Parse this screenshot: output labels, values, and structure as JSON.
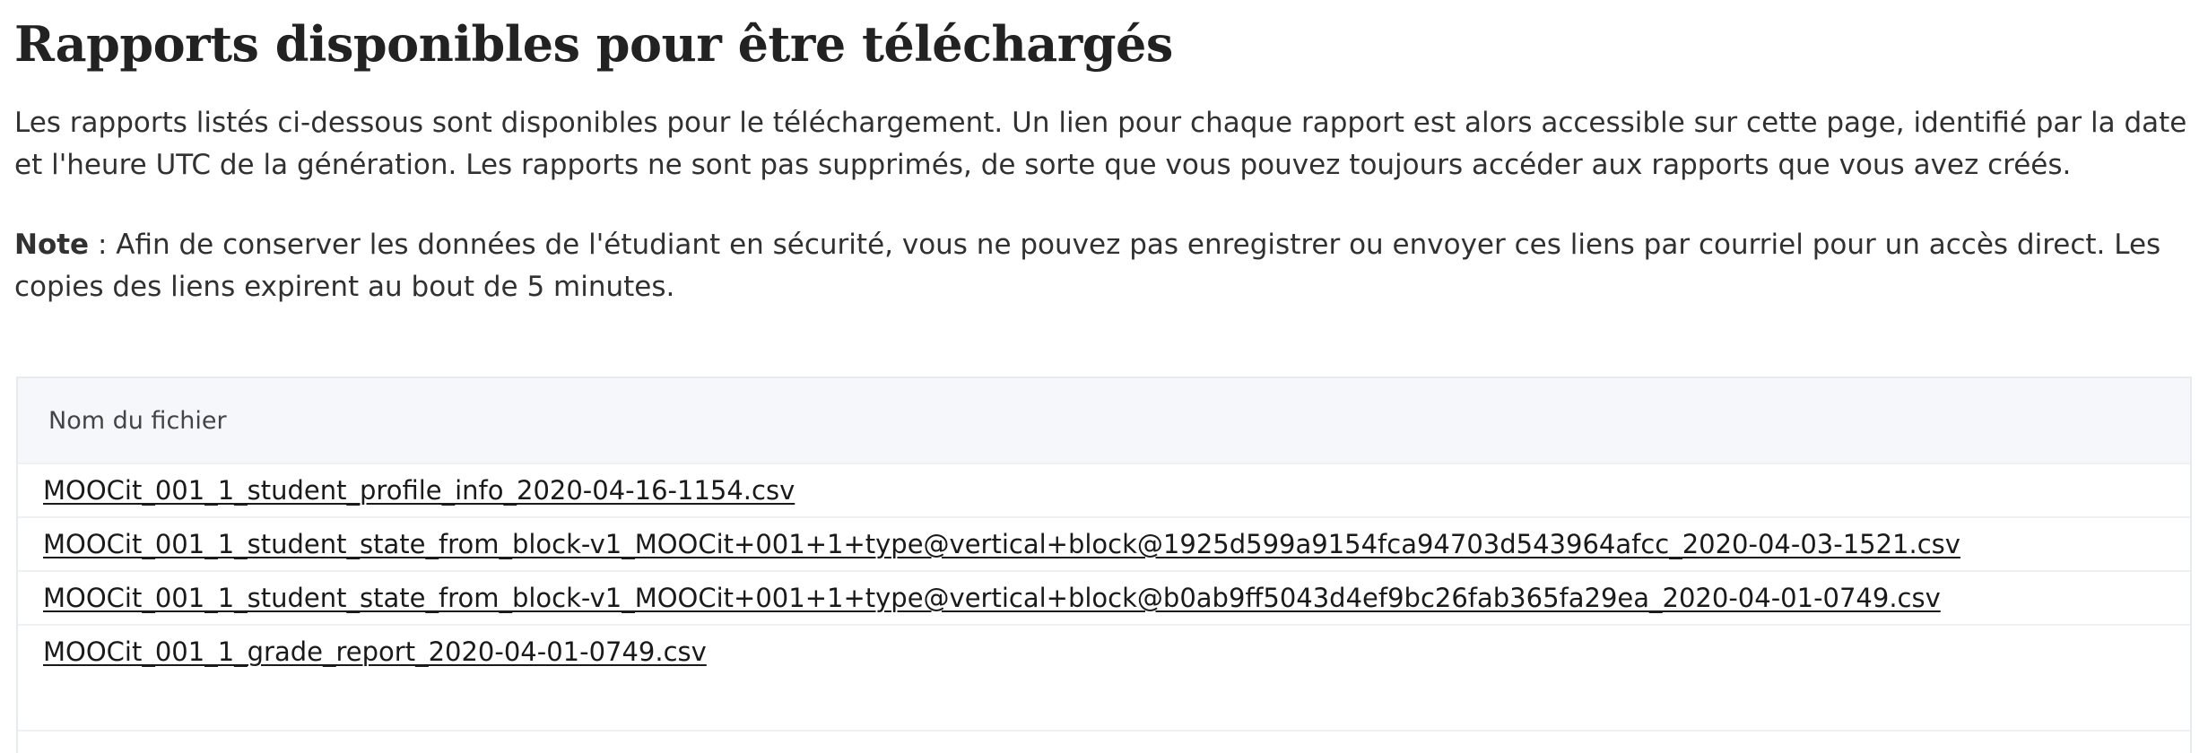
{
  "header": {
    "title": "Rapports disponibles pour être téléchargés"
  },
  "intro": {
    "text": "Les rapports listés ci-dessous sont disponibles pour le téléchargement. Un lien pour chaque rapport est alors accessible sur cette page, identifié par la date et l'heure UTC de la génération. Les rapports ne sont pas supprimés, de sorte que vous pouvez toujours accéder aux rapports que vous avez créés."
  },
  "note": {
    "label": "Note",
    "text": " : Afin de conserver les données de l'étudiant en sécurité, vous ne pouvez pas enregistrer ou envoyer ces liens par courriel pour un accès direct. Les copies des liens expirent au bout de 5 minutes."
  },
  "table": {
    "column_header": "Nom du fichier",
    "files": [
      "MOOCit_001_1_student_profile_info_2020-04-16-1154.csv",
      "MOOCit_001_1_student_state_from_block-v1_MOOCit+001+1+type@vertical+block@1925d599a9154fca94703d543964afcc_2020-04-03-1521.csv",
      "MOOCit_001_1_student_state_from_block-v1_MOOCit+001+1+type@vertical+block@b0ab9ff5043d4ef9bc26fab365fa29ea_2020-04-01-0749.csv",
      "MOOCit_001_1_grade_report_2020-04-01-0749.csv"
    ]
  }
}
